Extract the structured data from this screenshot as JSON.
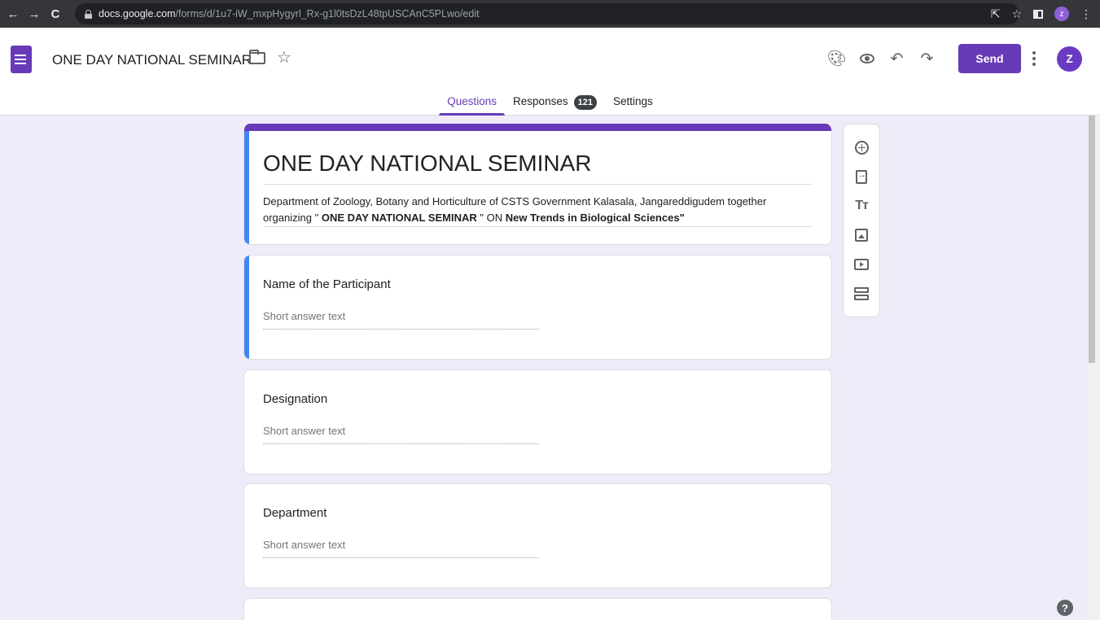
{
  "browser": {
    "url_domain": "docs.google.com",
    "url_path": "/forms/d/1u7-iW_mxpHygyrl_Rx-g1l0tsDzL48tpUSCAnC5PLwo/edit",
    "profile_initial": "z"
  },
  "header": {
    "doc_title": "ONE DAY NATIONAL SEMINAR",
    "send_label": "Send",
    "user_initial": "Z"
  },
  "tabs": [
    {
      "label": "Questions"
    },
    {
      "label": "Responses",
      "count": "121"
    },
    {
      "label": "Settings"
    }
  ],
  "form": {
    "title": "ONE DAY NATIONAL SEMINAR",
    "desc_part1": "Department of Zoology, Botany and Horticulture  of CSTS Government Kalasala, Jangareddigudem together organizing \" ",
    "desc_bold1": "ONE DAY NATIONAL SEMINAR",
    "desc_part2": " \" ON ",
    "desc_bold2": "New Trends in Biological Sciences\""
  },
  "questions": [
    {
      "title": "Name of the Participant",
      "placeholder": "Short answer text"
    },
    {
      "title": "Designation",
      "placeholder": "Short answer text"
    },
    {
      "title": "Department",
      "placeholder": "Short answer text"
    }
  ],
  "toolbar": {
    "text_icon_label": "Tт"
  },
  "colors": {
    "accent": "#673ab7",
    "background": "#f0ebf8",
    "selected_bar": "#4285f4"
  }
}
